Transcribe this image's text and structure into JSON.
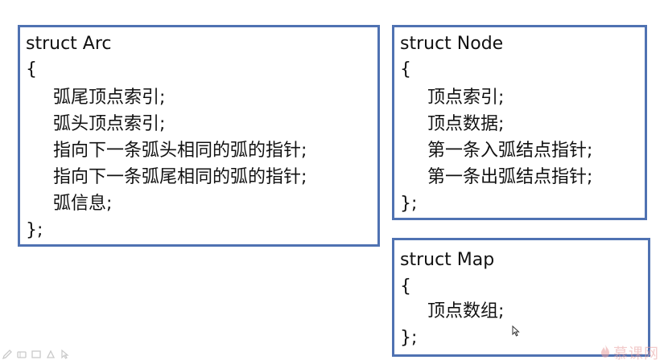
{
  "arc": {
    "header": "struct Arc",
    "open": "{",
    "fields": [
      "弧尾顶点索引;",
      "弧头顶点索引;",
      "指向下一条弧头相同的弧的指针;",
      "指向下一条弧尾相同的弧的指针;",
      "弧信息;"
    ],
    "close": "};"
  },
  "node": {
    "header": "struct Node",
    "open": "{",
    "fields": [
      "顶点索引;",
      "顶点数据;",
      "第一条入弧结点指针;",
      "第一条出弧结点指针;"
    ],
    "close": "};"
  },
  "map": {
    "header": "struct Map",
    "open": "{",
    "fields": [
      "顶点数组;"
    ],
    "close": "};"
  },
  "watermark": {
    "text": "慕课网"
  },
  "colors": {
    "box_border": "#4f72b2",
    "text": "#111111",
    "watermark": "#e8a0a0"
  },
  "icons": [
    "pen-icon",
    "eraser-icon",
    "screen-icon",
    "shape-icon",
    "pointer-icon"
  ]
}
